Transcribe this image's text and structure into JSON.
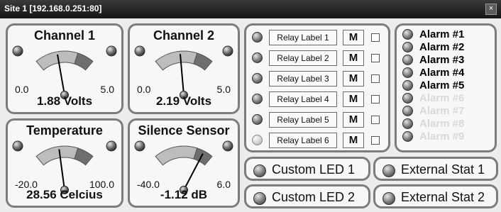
{
  "window": {
    "title": "Site 1 [192.168.0.251:80]",
    "close_glyph": "×"
  },
  "gauges": [
    {
      "title": "Channel 1",
      "min": "0.0",
      "max": "5.0",
      "value": "1.88 Volts",
      "level": 0.376
    },
    {
      "title": "Channel 2",
      "min": "0.0",
      "max": "5.0",
      "value": "2.19 Volts",
      "level": 0.438
    },
    {
      "title": "Temperature",
      "min": "-20.0",
      "max": "100.0",
      "value": "28.56 Celcius",
      "level": 0.405
    },
    {
      "title": "Silence Sensor",
      "min": "-40.0",
      "max": "6.0",
      "value": "-1.12 dB",
      "level": 0.845
    }
  ],
  "relays": [
    {
      "label": "Relay Label 1",
      "m": "M"
    },
    {
      "label": "Relay Label 2",
      "m": "M"
    },
    {
      "label": "Relay Label 3",
      "m": "M"
    },
    {
      "label": "Relay Label 4",
      "m": "M"
    },
    {
      "label": "Relay Label 5",
      "m": "M"
    },
    {
      "label": "Relay Label 6",
      "m": "M"
    }
  ],
  "alarms": [
    {
      "label": "Alarm #1",
      "active": true
    },
    {
      "label": "Alarm #2",
      "active": true
    },
    {
      "label": "Alarm #3",
      "active": true
    },
    {
      "label": "Alarm #4",
      "active": true
    },
    {
      "label": "Alarm #5",
      "active": true
    },
    {
      "label": "Alarm #6",
      "active": false
    },
    {
      "label": "Alarm #7",
      "active": false
    },
    {
      "label": "Alarm #8",
      "active": false
    },
    {
      "label": "Alarm #9",
      "active": false
    }
  ],
  "custom_leds": [
    "Custom LED 1",
    "Custom LED 2"
  ],
  "external_stats": [
    "External Stat 1",
    "External Stat 2"
  ]
}
